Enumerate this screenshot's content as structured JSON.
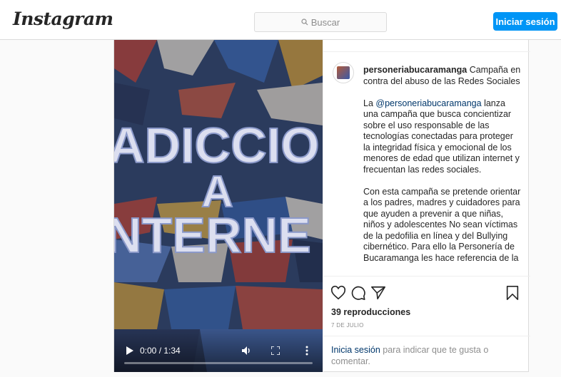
{
  "header": {
    "logo": "Instagram",
    "search_placeholder": "Buscar",
    "login_button": "Iniciar sesión"
  },
  "video": {
    "overlay_text": [
      "ADICCIO",
      "A",
      "NTERNE"
    ],
    "time": "0:00 / 1:34",
    "progress": 0.0,
    "icons": [
      "play-icon",
      "volume-icon",
      "fullscreen-icon",
      "more-vertical-icon"
    ]
  },
  "post": {
    "username": "personeriabucaramanga",
    "caption_title": "Campaña en contra del abuso de las Redes Sociales",
    "paragraph1_mention": "@personeriabucaramanga",
    "paragraph1_prefix": "La ",
    "paragraph1_rest": " lanza una campaña que busca concientizar sobre el uso responsable de las tecnologías conectadas para proteger la integridad física y emocional de los menores de edad que utilizan internet y frecuentan las redes sociales.",
    "paragraph2": "Con esta campaña se pretende orientar a los padres, madres y cuidadores para que ayuden a prevenir a que niñas, niños y adolescentes No sean víctimas de la pedofilia en línea y del Bullying cibernético. Para ello la Personería de Bucaramanga les hace referencia de la"
  },
  "actions": {
    "icons": [
      "heart-icon",
      "comment-icon",
      "share-icon",
      "bookmark-icon"
    ],
    "views": "39 reproducciones",
    "date": "7 DE JULIO",
    "login_link": "Inicia sesión",
    "login_rest": " para indicar que te gusta o comentar."
  },
  "colors": {
    "accent": "#0095f6",
    "link": "#00376b",
    "muted": "#8e8e8e",
    "border": "#dbdbdb"
  }
}
